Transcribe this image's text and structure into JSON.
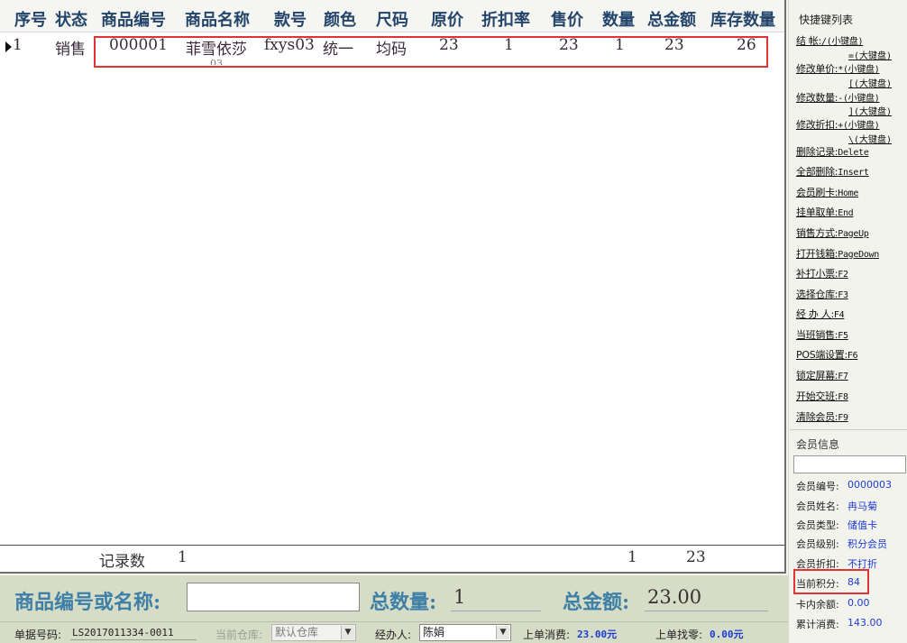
{
  "grid": {
    "headers": [
      "序号",
      "状态",
      "商品编号",
      "商品名称",
      "款号",
      "颜色",
      "尺码",
      "原价",
      "折扣率",
      "售价",
      "数量",
      "总金额",
      "库存数量"
    ],
    "rows": [
      {
        "index": "1",
        "status": "销售",
        "code": "000001",
        "name": "菲雪依莎",
        "name_overflow": "03",
        "style_no": "fxys03",
        "color": "统一",
        "size": "均码",
        "original_price": "23",
        "discount": "1",
        "price": "23",
        "qty": "1",
        "total": "23",
        "stock": "26"
      }
    ],
    "footer": {
      "record_label": "记录数",
      "record_count": "1",
      "sum_qty": "1",
      "sum_total": "23"
    }
  },
  "entry": {
    "code_label": "商品编号或名称:",
    "code_value": "",
    "qty_label": "总数量:",
    "qty_value": "1",
    "amount_label": "总金额:",
    "amount_value": "23.00"
  },
  "status": {
    "doc_label": "单据号码:",
    "doc_value": "LS2017011334-0011",
    "warehouse_label": "当前仓库:",
    "warehouse_value": "默认仓库",
    "operator_label": "经办人:",
    "operator_value": "陈娟",
    "last_spend_label": "上单消费:",
    "last_spend_value": "23.00元",
    "last_change_label": "上单找零:",
    "last_change_value": "0.00元"
  },
  "shortcuts": {
    "title": "快捷键列表",
    "items": [
      {
        "label": "结    帐:",
        "key": "/(小键盘)",
        "extra": "=(大键盘)"
      },
      {
        "label": "修改单价:",
        "key": "*(小键盘)",
        "extra": "[(大键盘)"
      },
      {
        "label": "修改数量:",
        "key": "-(小键盘)",
        "extra": "](大键盘)"
      },
      {
        "label": "修改折扣:",
        "key": "+(小键盘)",
        "extra": "\\(大键盘)"
      },
      {
        "label": "删除记录:",
        "key": "Delete"
      },
      {
        "label": "全部删除:",
        "key": "Insert"
      },
      {
        "label": "会员刷卡:",
        "key": "Home"
      },
      {
        "label": "挂单取单:",
        "key": "End"
      },
      {
        "label": "销售方式:",
        "key": "PageUp"
      },
      {
        "label": "打开钱箱:",
        "key": "PageDown"
      },
      {
        "label": "补打小票:",
        "key": "F2"
      },
      {
        "label": "选择仓库:",
        "key": "F3"
      },
      {
        "label": "经 办 人:",
        "key": "F4"
      },
      {
        "label": "当班销售:",
        "key": "F5"
      },
      {
        "label": "POS端设置:",
        "key": "F6"
      },
      {
        "label": "锁定屏幕:",
        "key": "F7"
      },
      {
        "label": "开始交班:",
        "key": "F8"
      },
      {
        "label": "清除会员:",
        "key": "F9"
      }
    ]
  },
  "member": {
    "title": "会员信息",
    "search_value": "",
    "fields": [
      {
        "label": "会员编号:",
        "value": "0000003"
      },
      {
        "label": "会员姓名:",
        "value": "冉马菊"
      },
      {
        "label": "会员类型:",
        "value": "储值卡"
      },
      {
        "label": "会员级别:",
        "value": "积分会员"
      },
      {
        "label": "会员折扣:",
        "value": "不打折"
      },
      {
        "label": "当前积分:",
        "value": "84"
      },
      {
        "label": "卡内余额:",
        "value": "0.00"
      },
      {
        "label": "累计消费:",
        "value": "143.00"
      }
    ]
  }
}
